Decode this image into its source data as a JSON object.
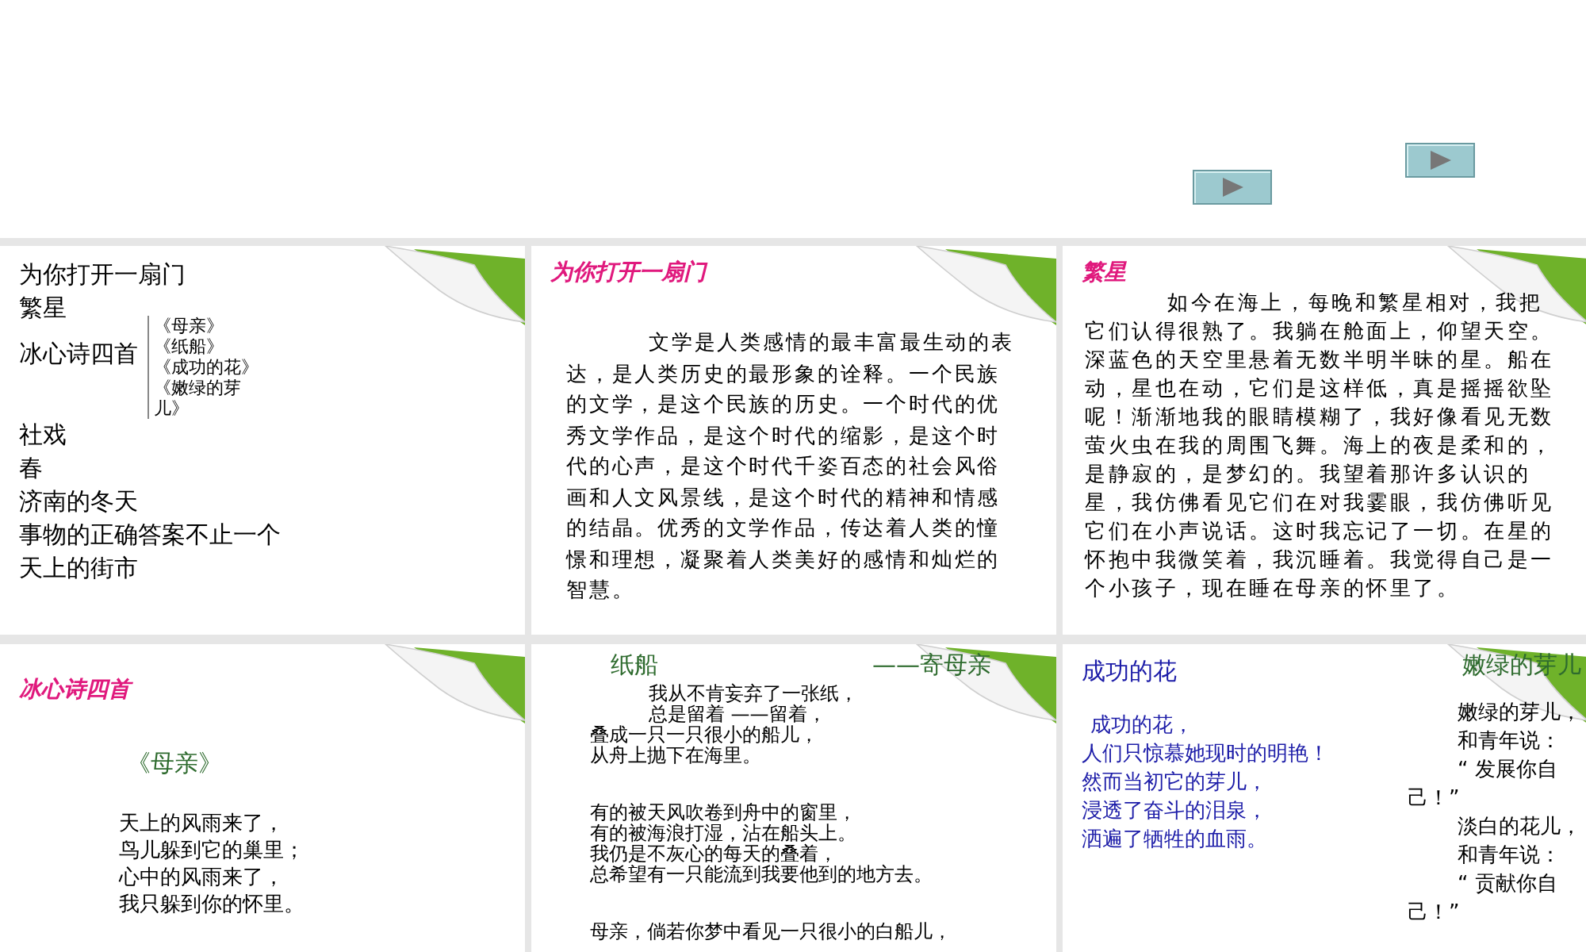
{
  "slides": [
    {
      "kind": "outline",
      "items": [
        {
          "text": "为你打开一扇门"
        },
        {
          "text": "繁星"
        },
        {
          "text": "冰心诗四首",
          "children": [
            {
              "text": "《母亲》"
            },
            {
              "text": "《纸船》"
            },
            {
              "text": "《成功的花》"
            },
            {
              "text": "《嫩绿的芽儿》"
            }
          ]
        },
        {
          "text": "社戏"
        },
        {
          "text": "春"
        },
        {
          "text": "济南的冬天"
        },
        {
          "text": "事物的正确答案不止一个"
        },
        {
          "text": "天上的街市"
        }
      ]
    },
    {
      "kind": "prose",
      "title": "为你打开一扇门",
      "body": "文学是人类感情的最丰富最生动的表达，是人类历史的最形象的诠释。一个民族的文学，是这个民族的历史。一个时代的优秀文学作品，是这个时代的缩影，是这个时代的心声，是这个时代千姿百态的社会风俗画和人文风景线，是这个时代的精神和情感的结晶。优秀的文学作品，传达着人类的憧憬和理想，凝聚着人类美好的感情和灿烂的智慧。"
    },
    {
      "kind": "prose",
      "title": "繁星",
      "body": "如今在海上，每晚和繁星相对，我把它们认得很熟了。我躺在舱面上，仰望天空。深蓝色的天空里悬着无数半明半昧的星。船在动，星也在动，它们是这样低，真是摇摇欲坠呢！渐渐地我的眼睛模糊了，我好像看见无数萤火虫在我的周围飞舞。海上的夜是柔和的，是静寂的，是梦幻的。我望着那许多认识的星，我仿佛看见它们在对我霎眼，我仿佛听见它们在小声说话。这时我忘记了一切。在星的怀抱中我微笑着，我沉睡着。我觉得自己是一个小孩子，现在睡在母亲的怀里了。"
    },
    {
      "kind": "poem",
      "title": "冰心诗四首",
      "subtitle": "《母亲》",
      "lines": [
        "天上的风雨来了，",
        "鸟儿躲到它的巢里；",
        "心中的风雨来了，",
        "我只躲到你的怀里。"
      ]
    },
    {
      "kind": "stanzas",
      "title": "纸船",
      "dedication": "——寄母亲",
      "stanzas": [
        [
          {
            "text": "我从不肯妄弃了一张纸，",
            "indented": true
          },
          {
            "text": "总是留着 ——留着，",
            "indented": true
          },
          {
            "text": "叠成一只一只很小的船儿，",
            "indented": false
          },
          {
            "text": "从舟上抛下在海里。",
            "indented": false
          }
        ],
        [
          {
            "text": "有的被天风吹卷到舟中的窗里，",
            "indented": false
          },
          {
            "text": "有的被海浪打湿，沾在船头上。",
            "indented": false
          },
          {
            "text": "我仍是不灰心的每天的叠着，",
            "indented": false
          },
          {
            "text": "总希望有一只能流到我要他到的地方去。",
            "indented": false
          }
        ],
        [
          {
            "text": "母亲，倘若你梦中看见一只很小的白船儿，",
            "indented": false
          }
        ]
      ]
    },
    {
      "kind": "columns",
      "columns": [
        {
          "title": "成功的花",
          "color": "#1c1ca8",
          "lines": [
            {
              "text": "成功的花，",
              "indented": true
            },
            {
              "text": "人们只惊慕她现时的明艳！",
              "indented": false
            },
            {
              "text": "然而当初它的芽儿，",
              "indented": false
            },
            {
              "text": "浸透了奋斗的泪泉，",
              "indented": false
            },
            {
              "text": "洒遍了牺牲的血雨。",
              "indented": false
            }
          ]
        },
        {
          "title": "嫩绿的芽儿",
          "color": "#2e6b2e",
          "lines": [
            {
              "text": "嫩绿的芽儿，",
              "indented": true
            },
            {
              "text": "和青年说：",
              "indented": true
            },
            {
              "text": "“ 发展你自",
              "indented": true
            },
            {
              "text": "己！”",
              "indented": false
            },
            {
              "text": "淡白的花儿，",
              "indented": true
            },
            {
              "text": "和青年说：",
              "indented": true
            },
            {
              "text": "“ 贡献你自",
              "indented": true
            },
            {
              "text": "己！”",
              "indented": false
            }
          ]
        }
      ]
    }
  ]
}
